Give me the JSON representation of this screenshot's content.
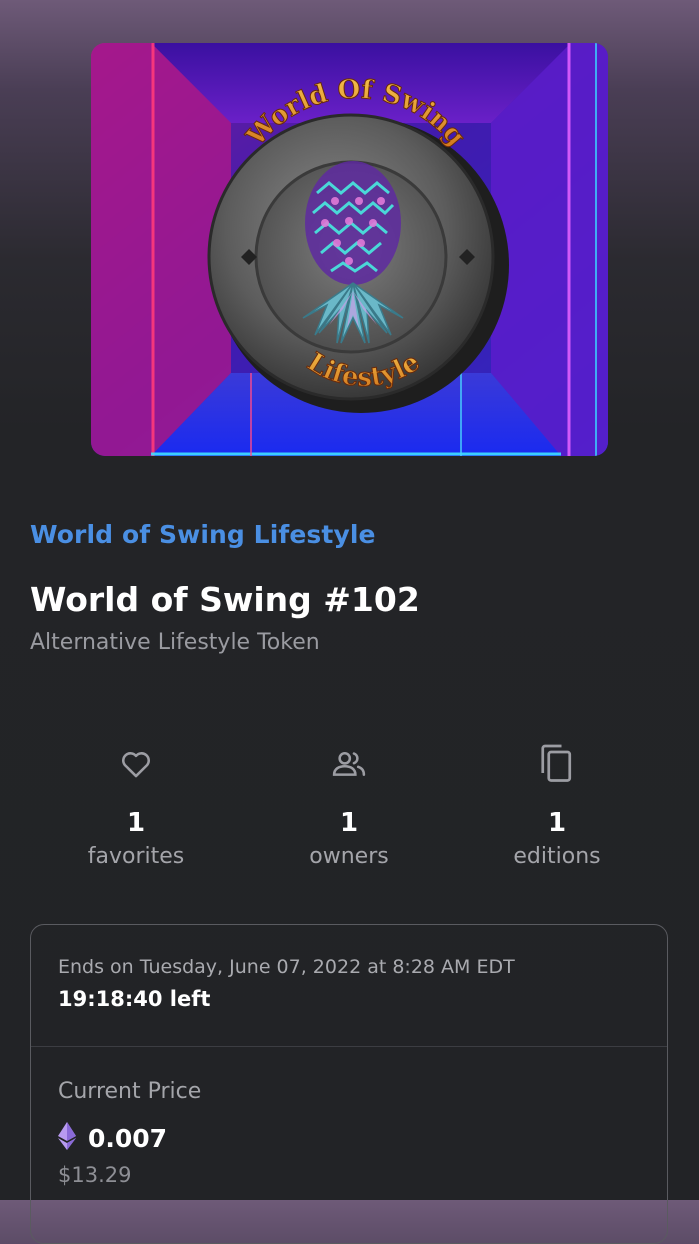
{
  "artwork": {
    "top_text": "World Of Swing",
    "bottom_text": "Lifestyle"
  },
  "collection": {
    "name": "World of Swing Lifestyle"
  },
  "token": {
    "title": "World of Swing #102",
    "subtitle": "Alternative Lifestyle Token"
  },
  "stats": {
    "favorites": {
      "count": "1",
      "label": "favorites",
      "icon": "heart-icon"
    },
    "owners": {
      "count": "1",
      "label": "owners",
      "icon": "people-icon"
    },
    "editions": {
      "count": "1",
      "label": "editions",
      "icon": "copy-icon"
    }
  },
  "auction": {
    "ends_text": "Ends on Tuesday, June 07, 2022 at 8:28 AM EDT",
    "time_left": "19:18:40 left",
    "price_label": "Current Price",
    "price_value": "0.007",
    "price_usd": "$13.29",
    "currency_icon": "ethereum-icon"
  },
  "colors": {
    "accent": "#4a8fe3",
    "background": "#232427",
    "muted_text": "#a4a5aa",
    "eth_purple": "#9b7fe8"
  }
}
